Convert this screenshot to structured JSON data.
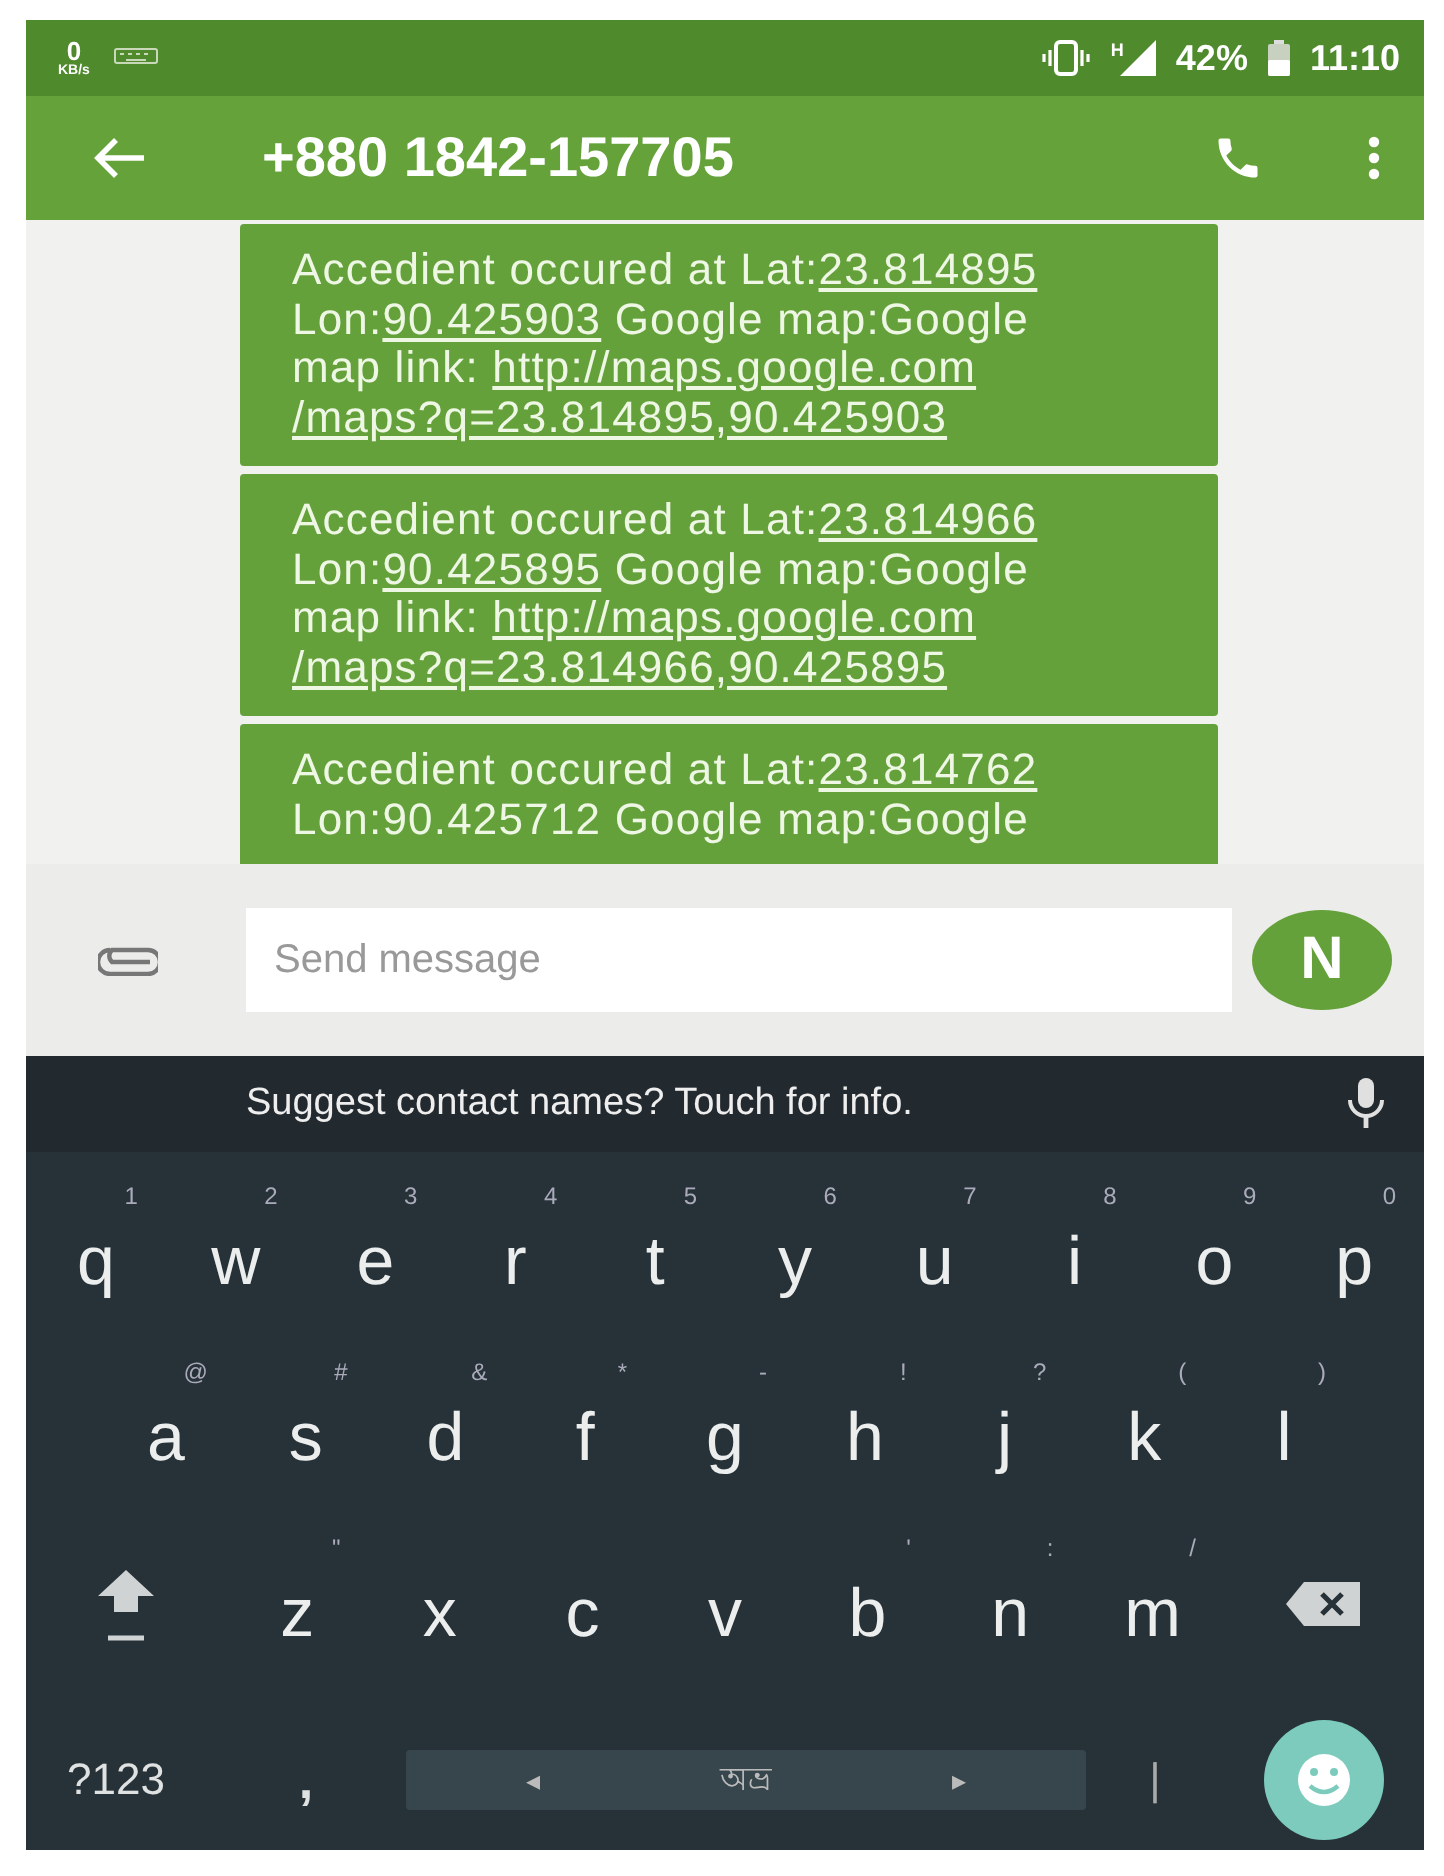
{
  "status_bar": {
    "speed": "0",
    "speed_unit": "KB/s",
    "network": "H",
    "battery": "42%",
    "time": "11:10"
  },
  "app_bar": {
    "title": "+880 1842-157705"
  },
  "messages": [
    {
      "lines": [
        [
          {
            "text": "Accedient occured at Lat:",
            "link": false
          },
          {
            "text": "23.814895",
            "link": true
          }
        ],
        [
          {
            "text": "Lon:",
            "link": false
          },
          {
            "text": "90.425903",
            "link": true
          },
          {
            "text": " Google map:Google",
            "link": false
          }
        ],
        [
          {
            "text": "map link: ",
            "link": false
          },
          {
            "text": "http://maps.google.com",
            "link": true
          }
        ],
        [
          {
            "text": "/maps?q=23.814895,90.425903",
            "link": true
          }
        ]
      ]
    },
    {
      "lines": [
        [
          {
            "text": "Accedient occured at Lat:",
            "link": false
          },
          {
            "text": "23.814966",
            "link": true
          }
        ],
        [
          {
            "text": "Lon:",
            "link": false
          },
          {
            "text": "90.425895",
            "link": true
          },
          {
            "text": " Google map:Google",
            "link": false
          }
        ],
        [
          {
            "text": "map link: ",
            "link": false
          },
          {
            "text": "http://maps.google.com",
            "link": true
          }
        ],
        [
          {
            "text": "/maps?q=23.814966,90.425895",
            "link": true
          }
        ]
      ]
    },
    {
      "lines": [
        [
          {
            "text": "Accedient occured at Lat:",
            "link": false
          },
          {
            "text": "23.814762",
            "link": true
          }
        ],
        [
          {
            "text": "Lon:90.425712 Google map:Google",
            "link": false
          }
        ]
      ]
    }
  ],
  "composer": {
    "placeholder": "Send message",
    "avatar_letter": "N"
  },
  "suggestion": {
    "text": "Suggest contact names? Touch for info."
  },
  "keyboard": {
    "rows": [
      [
        {
          "kind": "letter",
          "label": "q",
          "hint": "1"
        },
        {
          "kind": "letter",
          "label": "w",
          "hint": "2"
        },
        {
          "kind": "letter",
          "label": "e",
          "hint": "3"
        },
        {
          "kind": "letter",
          "label": "r",
          "hint": "4"
        },
        {
          "kind": "letter",
          "label": "t",
          "hint": "5"
        },
        {
          "kind": "letter",
          "label": "y",
          "hint": "6"
        },
        {
          "kind": "letter",
          "label": "u",
          "hint": "7"
        },
        {
          "kind": "letter",
          "label": "i",
          "hint": "8"
        },
        {
          "kind": "letter",
          "label": "o",
          "hint": "9"
        },
        {
          "kind": "letter",
          "label": "p",
          "hint": "0"
        }
      ],
      [
        {
          "kind": "letter",
          "label": "a",
          "hint": "@"
        },
        {
          "kind": "letter",
          "label": "s",
          "hint": "#"
        },
        {
          "kind": "letter",
          "label": "d",
          "hint": "&"
        },
        {
          "kind": "letter",
          "label": "f",
          "hint": "*"
        },
        {
          "kind": "letter",
          "label": "g",
          "hint": "-"
        },
        {
          "kind": "letter",
          "label": "h",
          "hint": "!"
        },
        {
          "kind": "letter",
          "label": "j",
          "hint": "?"
        },
        {
          "kind": "letter",
          "label": "k",
          "hint": "("
        },
        {
          "kind": "letter",
          "label": "l",
          "hint": ")"
        }
      ],
      [
        {
          "kind": "shift"
        },
        {
          "kind": "letter",
          "label": "z",
          "hint": "\""
        },
        {
          "kind": "letter",
          "label": "x"
        },
        {
          "kind": "letter",
          "label": "c"
        },
        {
          "kind": "letter",
          "label": "v"
        },
        {
          "kind": "letter",
          "label": "b",
          "hint": "'"
        },
        {
          "kind": "letter",
          "label": "n",
          "hint": ":"
        },
        {
          "kind": "letter",
          "label": "m",
          "hint": "/"
        },
        {
          "kind": "backspace"
        }
      ]
    ],
    "bottom_row": {
      "symbols_key": "?123",
      "comma_key": ",",
      "spacebar": {
        "label": "অভ্র",
        "left": "◂",
        "right": "▸"
      },
      "period_key": "|"
    }
  }
}
